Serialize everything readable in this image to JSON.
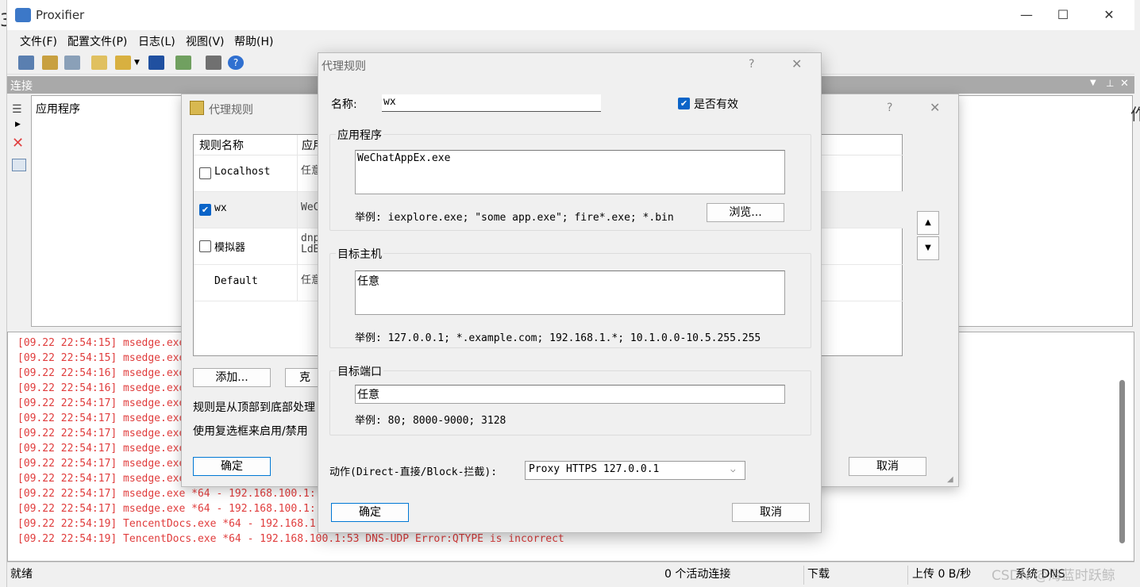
{
  "app": {
    "title": "Proxifier",
    "menu": [
      "文件(F)",
      "配置文件(P)",
      "日志(L)",
      "视图(V)",
      "帮助(H)"
    ],
    "connections_header": "连接",
    "connections_column": "应用程序"
  },
  "log": {
    "lines": [
      "[09.22 22:54:15] msedge.exe",
      "[09.22 22:54:15] msedge.exe",
      "[09.22 22:54:16] msedge.exe",
      "[09.22 22:54:16] msedge.exe",
      "[09.22 22:54:17] msedge.exe",
      "[09.22 22:54:17] msedge.exe",
      "[09.22 22:54:17] msedge.exe",
      "[09.22 22:54:17] msedge.exe",
      "[09.22 22:54:17] msedge.exe",
      "[09.22 22:54:17] msedge.exe",
      "[09.22 22:54:17] msedge.exe *64 - 192.168.100.1:",
      "[09.22 22:54:17] msedge.exe *64 - 192.168.100.1:",
      "[09.22 22:54:19] TencentDocs.exe *64 - 192.168.1",
      "[09.22 22:54:19] TencentDocs.exe *64 - 192.168.100.1:53 DNS-UDP Error:QTYPE is incorrect"
    ]
  },
  "status": {
    "ready": "就绪",
    "active": "0 个活动连接",
    "down": "下载",
    "up": "上传 0 B/秒",
    "dns": "系统 DNS",
    "watermark": "CSDN @海蓝时跃鲸"
  },
  "rules_dialog": {
    "title": "代理规则",
    "help": "?",
    "close": "✕",
    "col_name": "规则名称",
    "col_app": "应用",
    "rules": [
      {
        "name": "Localhost",
        "app": "任意",
        "checked": false,
        "checkbox": true
      },
      {
        "name": "wx",
        "app": "WeC",
        "checked": true,
        "checkbox": true
      },
      {
        "name": "模拟器",
        "app": "dnp\nLdB",
        "checked": false,
        "checkbox": true
      },
      {
        "name": "Default",
        "app": "任意",
        "checked": false,
        "checkbox": false
      }
    ],
    "add": "添加...",
    "clone": "克",
    "note1": "规则是从顶部到底部处理",
    "note2": "使用复选框来启用/禁用",
    "ok": "确定",
    "cancel": "取消",
    "up": "▲",
    "down": "▼"
  },
  "edit_dialog": {
    "title": "代理规则",
    "help": "?",
    "close": "✕",
    "name_label": "名称:",
    "name_value": "wx",
    "enabled_label": "是否有效",
    "enabled": true,
    "apps_group": "应用程序",
    "apps_value": "WeChatAppEx.exe",
    "apps_hint": "举例: iexplore.exe; \"some app.exe\"; fire*.exe; *.bin",
    "browse": "浏览...",
    "hosts_group": "目标主机",
    "hosts_value": "任意",
    "hosts_hint": "举例: 127.0.0.1; *.example.com; 192.168.1.*; 10.1.0.0-10.5.255.255",
    "ports_group": "目标端口",
    "ports_value": "任意",
    "ports_hint": "举例: 80; 8000-9000; 3128",
    "action_label": "动作(Direct-直接/Block-拦截):",
    "action_value": "Proxy HTTPS 127.0.0.1",
    "ok": "确定",
    "cancel": "取消"
  }
}
